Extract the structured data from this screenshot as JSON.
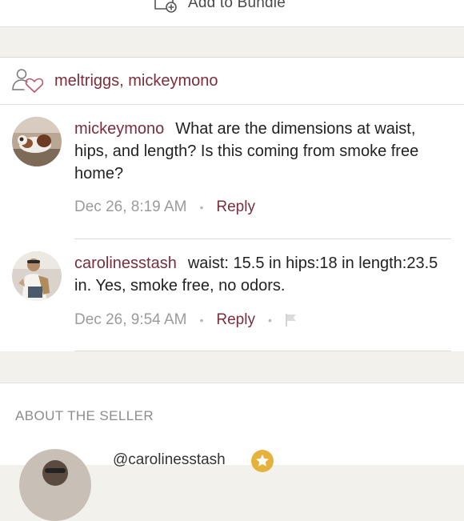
{
  "bundle": {
    "label": "Add to Bundle"
  },
  "likes": {
    "users": [
      "meltriggs",
      "mickeymono"
    ],
    "separator": ", "
  },
  "comments": [
    {
      "username": "mickeymono",
      "text": "What are the dimensions at waist, hips, and length? Is this coming from smoke free home?",
      "timestamp": "Dec 26, 8:19 AM",
      "reply_label": "Reply",
      "has_flag": false
    },
    {
      "username": "carolinesstash",
      "text": "waist: 15.5 in hips:18 in length:23.5 in. Yes, smoke free, no odors.",
      "timestamp": "Dec 26, 9:54 AM",
      "reply_label": "Reply",
      "has_flag": true
    }
  ],
  "meta_separator": "•",
  "seller": {
    "heading": "ABOUT THE SELLER",
    "handle": "@carolinesstash"
  },
  "icons": {
    "bundle": "bundle-add-icon",
    "likes": "likes-heart-user-icon",
    "flag": "flag-icon",
    "seller_badge": "star-badge-icon"
  },
  "colors": {
    "accent": "#7a2e3c",
    "muted_text": "#9b9b9b",
    "body_text": "#222222",
    "section_bg": "#f3f1ec",
    "badge": "#e5b23d"
  }
}
